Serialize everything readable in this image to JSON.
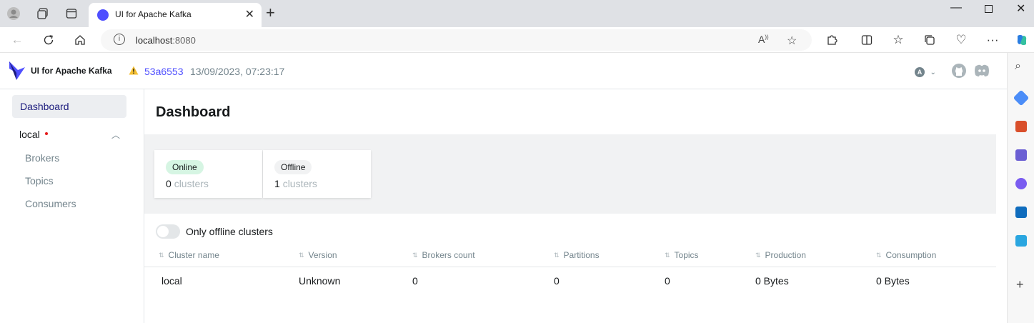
{
  "browser": {
    "tab_title": "UI for Apache Kafka",
    "url_host": "localhost",
    "url_port": ":8080"
  },
  "app": {
    "name": "UI for Apache Kafka",
    "commit": "53a6553",
    "commit_date": "13/09/2023, 07:23:17",
    "theme_letter": "A"
  },
  "sidebar": {
    "dashboard": "Dashboard",
    "cluster": "local",
    "items": [
      "Brokers",
      "Topics",
      "Consumers"
    ]
  },
  "main": {
    "title": "Dashboard",
    "online_label": "Online",
    "online_count": "0",
    "online_unit": "clusters",
    "offline_label": "Offline",
    "offline_count": "1",
    "offline_unit": "clusters",
    "toggle_label": "Only offline clusters"
  },
  "table": {
    "headers": [
      "Cluster name",
      "Version",
      "Brokers count",
      "Partitions",
      "Topics",
      "Production",
      "Consumption"
    ],
    "row": [
      "local",
      "Unknown",
      "0",
      "0",
      "0",
      "0 Bytes",
      "0 Bytes"
    ]
  },
  "colors": {
    "accent": "#4f4fff",
    "online_bg": "#d6f5e3",
    "error_dot": "#e51a1a"
  }
}
